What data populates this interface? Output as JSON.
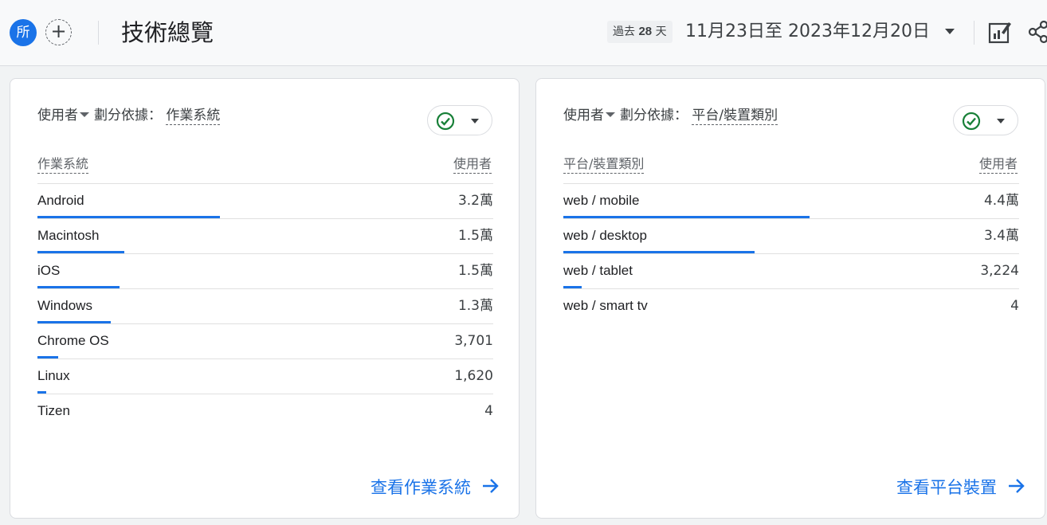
{
  "header": {
    "avatar_text": "所",
    "add_symbol": "+",
    "title": "技術總覽",
    "range_prefix": "過去",
    "range_days": "28",
    "range_suffix": "天",
    "date_range": "11月23日至 2023年12月20日"
  },
  "colors": {
    "accent": "#1a73e8",
    "check": "#188038"
  },
  "icons": [
    "avatar",
    "plus-icon",
    "chevron-down-icon",
    "edit-chart-icon",
    "share-icon",
    "check-circle-icon",
    "arrow-right-icon"
  ],
  "cards": [
    {
      "metric": "使用者",
      "split_label": "劃分依據：",
      "dimension": "作業系統",
      "col_dimension": "作業系統",
      "col_metric": "使用者",
      "rows": [
        {
          "label": "Android",
          "value": "3.2萬",
          "share": 0.4
        },
        {
          "label": "Macintosh",
          "value": "1.5萬",
          "share": 0.19
        },
        {
          "label": "iOS",
          "value": "1.5萬",
          "share": 0.18
        },
        {
          "label": "Windows",
          "value": "1.3萬",
          "share": 0.16
        },
        {
          "label": "Chrome OS",
          "value": "3,701",
          "share": 0.046
        },
        {
          "label": "Linux",
          "value": "1,620",
          "share": 0.02
        },
        {
          "label": "Tizen",
          "value": "4",
          "share": 0
        }
      ],
      "link": "查看作業系統"
    },
    {
      "metric": "使用者",
      "split_label": "劃分依據：",
      "dimension": "平台/裝置類別",
      "col_dimension": "平台/裝置類別",
      "col_metric": "使用者",
      "rows": [
        {
          "label": "web / mobile",
          "value": "4.4萬",
          "share": 0.54
        },
        {
          "label": "web / desktop",
          "value": "3.4萬",
          "share": 0.42
        },
        {
          "label": "web / tablet",
          "value": "3,224",
          "share": 0.04
        },
        {
          "label": "web / smart tv",
          "value": "4",
          "share": 0
        }
      ],
      "link": "查看平台裝置"
    }
  ]
}
